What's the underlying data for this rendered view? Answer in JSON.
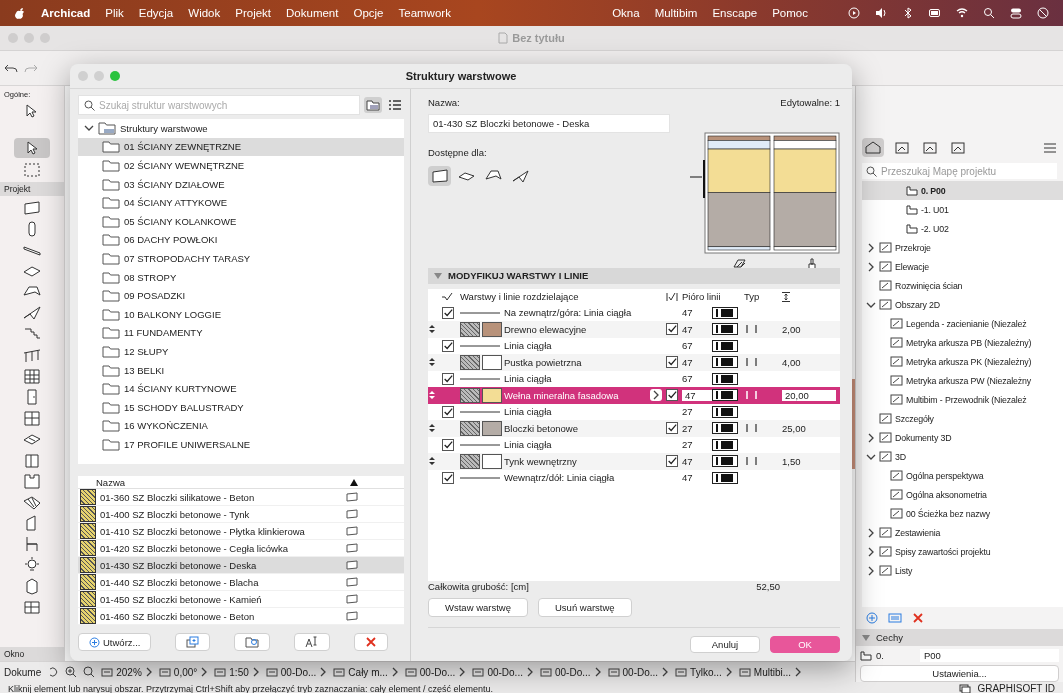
{
  "menu_bar": {
    "app": "Archicad",
    "items": [
      "Plik",
      "Edycja",
      "Widok",
      "Projekt",
      "Dokument",
      "Opcje",
      "Teamwork"
    ],
    "right_items": [
      "Okna",
      "Multibim",
      "Enscape",
      "Pomoc"
    ]
  },
  "window": {
    "title": "Bez tytułu"
  },
  "toolbox": {
    "general_label": "Ogólne:",
    "design_label": "Projekt",
    "bottom_label": "Okno"
  },
  "dialog": {
    "title": "Struktury warstwowe",
    "search_placeholder": "Szukaj struktur warstwowych",
    "tree": {
      "label": "Struktury warstwowe",
      "expanded": true,
      "children": [
        {
          "label": "01 ŚCIANY ZEWNĘTRZNE",
          "selected": true
        },
        {
          "label": "02 ŚCIANY WEWNĘTRZNE",
          "selected": false
        },
        {
          "label": "03 ŚCIANY DZIAŁOWE",
          "selected": false
        },
        {
          "label": "04 ŚCIANY ATTYKOWE",
          "selected": false
        },
        {
          "label": "05 ŚCIANY KOLANKOWE",
          "selected": false
        },
        {
          "label": "06 DACHY POWŁOKI",
          "selected": false
        },
        {
          "label": "07 STROPODACHY TARASY",
          "selected": false
        },
        {
          "label": "08 STROPY",
          "selected": false
        },
        {
          "label": "09 POSADZKI",
          "selected": false
        },
        {
          "label": "10 BALKONY LOGGIE",
          "selected": false
        },
        {
          "label": "11 FUNDAMENTY",
          "selected": false
        },
        {
          "label": "12 SŁUPY",
          "selected": false
        },
        {
          "label": "13 BELKI",
          "selected": false
        },
        {
          "label": "14 ŚCIANY KURTYNOWE",
          "selected": false
        },
        {
          "label": "15 SCHODY BALUSTRADY",
          "selected": false
        },
        {
          "label": "16 WYKOŃCZENIA",
          "selected": false
        },
        {
          "label": "17 PROFILE UNIWERSALNE",
          "selected": false
        }
      ]
    },
    "list_header": "Nazwa",
    "list": [
      {
        "label": "01-360 SZ Bloczki silikatowe - Beton",
        "selected": false
      },
      {
        "label": "01-400 SZ Bloczki betonowe - Tynk",
        "selected": false
      },
      {
        "label": "01-410 SZ Bloczki betonowe - Płytka klinkierowa",
        "selected": false
      },
      {
        "label": "01-420 SZ Bloczki betonowe - Cegła licówka",
        "selected": false
      },
      {
        "label": "01-430 SZ Bloczki betonowe - Deska",
        "selected": true
      },
      {
        "label": "01-440 SZ Bloczki betonowe - Blacha",
        "selected": false
      },
      {
        "label": "01-450 SZ Bloczki betonowe - Kamień",
        "selected": false
      },
      {
        "label": "01-460 SZ Bloczki betonowe - Beton",
        "selected": false
      }
    ],
    "create_button": "Utwórz...",
    "name_label": "Nazwa:",
    "editable": "Edytowalne: 1",
    "name_value": "01-430 SZ Bloczki betonowe - Deska",
    "available_label": "Dostępne dla:",
    "available_for": [
      {
        "selected": true
      },
      {
        "selected": false
      },
      {
        "selected": false
      },
      {
        "selected": false
      }
    ],
    "section_title": "MODYFIKUJ WARSTWY I LINIE",
    "columns": [
      "Warstwy i linie rozdzielające",
      "Pióro linii",
      "Typ"
    ],
    "rows": [
      {
        "kind": "line",
        "checked": true,
        "label": "Na zewnątrz/góra: Linia ciągła",
        "pen": "47"
      },
      {
        "kind": "layer",
        "label": "Drewno elewacyjne",
        "color": "#b8927a",
        "checked": true,
        "pen": "47",
        "thickness": "2,00",
        "selected": false
      },
      {
        "kind": "line",
        "checked": true,
        "label": "Linia ciągła",
        "pen": "67"
      },
      {
        "kind": "layer",
        "label": "Pustka powietrzna",
        "color": "#ffffff",
        "checked": true,
        "pen": "47",
        "thickness": "4,00",
        "selected": false
      },
      {
        "kind": "line",
        "checked": true,
        "label": "Linia ciągła",
        "pen": "67"
      },
      {
        "kind": "layer",
        "label": "Wełna mineralna fasadowa",
        "color": "#f3dd95",
        "checked": true,
        "pen": "47",
        "thickness": "20,00",
        "selected": true
      },
      {
        "kind": "line",
        "checked": true,
        "label": "Linia ciągła",
        "pen": "27"
      },
      {
        "kind": "layer",
        "label": "Bloczki betonowe",
        "color": "#b4aca6",
        "checked": true,
        "pen": "27",
        "thickness": "25,00",
        "selected": false
      },
      {
        "kind": "line",
        "checked": true,
        "label": "Linia ciągła",
        "pen": "27"
      },
      {
        "kind": "layer",
        "label": "Tynk wewnętrzny",
        "color": "#ffffff",
        "checked": true,
        "pen": "47",
        "thickness": "1,50",
        "selected": false
      },
      {
        "kind": "line",
        "checked": true,
        "label": "Wewnątrz/dół: Linia ciągła",
        "pen": "47"
      }
    ],
    "total_label": "Całkowita grubość: [cm]",
    "total_value": "52,50",
    "insert_button": "Wstaw warstwę",
    "delete_button": "Usuń warstwę",
    "cancel_button": "Anuluj",
    "ok_button": "OK"
  },
  "project_map": {
    "search_placeholder": "Przeszukaj Mapę projektu",
    "stories": [
      {
        "label": "0. P00",
        "selected": true
      },
      {
        "label": "-1. U01",
        "selected": false
      },
      {
        "label": "-2. U02",
        "selected": false
      }
    ],
    "items": [
      {
        "label": "Przekroje",
        "expanded": false
      },
      {
        "label": "Elewacje",
        "expanded": false
      },
      {
        "label": "Rozwinięcia ścian"
      },
      {
        "label": "Obszary 2D",
        "expanded": true,
        "children": [
          {
            "label": "Legenda - zacienianie (Niezależ"
          },
          {
            "label": "Metryka arkusza PB (Niezależny)"
          },
          {
            "label": "Metryka arkusza PK (Niezależny)"
          },
          {
            "label": "Metryka arkusza PW (Niezależny"
          },
          {
            "label": "Multibim - Przewodnik (Niezależ"
          }
        ]
      },
      {
        "label": "Szczegóły"
      },
      {
        "label": "Dokumenty 3D",
        "expanded": false
      },
      {
        "label": "3D",
        "expanded": true,
        "children": [
          {
            "label": "Ogólna perspektywa"
          },
          {
            "label": "Ogólna aksonometria"
          },
          {
            "label": "00 Ścieżka bez nazwy"
          }
        ]
      },
      {
        "label": "Zestawienia",
        "expanded": false
      },
      {
        "label": "Spisy zawartości projektu",
        "expanded": false
      },
      {
        "label": "Listy",
        "expanded": false
      }
    ]
  },
  "properties": {
    "title": "Cechy",
    "id": "0.",
    "name": "P00",
    "settings_button": "Ustawienia..."
  },
  "navigator": {
    "label": "Dokume",
    "items": [
      "202%",
      "0,00°",
      "1:50",
      "00-Do...",
      "Cały m...",
      "00-Do...",
      "00-Do...",
      "00-Do...",
      "00-Do...",
      "Tylko...",
      "Multibi..."
    ]
  },
  "status_bar": {
    "hint": "Kliknij element lub narysuj obszar. Przytrzymaj Ctrl+Shift aby przełączyć tryb zaznaczania: cały element / część elementu.",
    "brand": "GRAPHISOFT ID"
  }
}
